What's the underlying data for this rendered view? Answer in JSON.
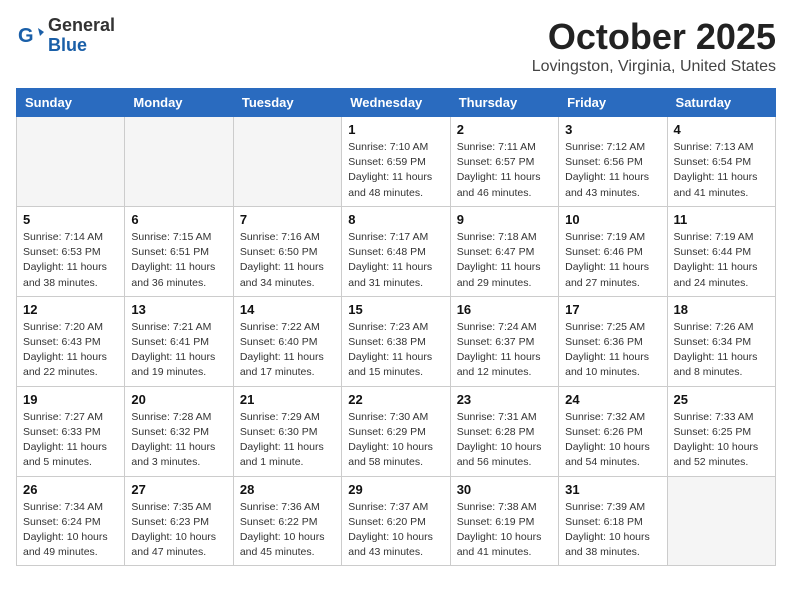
{
  "header": {
    "logo_general": "General",
    "logo_blue": "Blue",
    "month": "October 2025",
    "location": "Lovingston, Virginia, United States"
  },
  "weekdays": [
    "Sunday",
    "Monday",
    "Tuesday",
    "Wednesday",
    "Thursday",
    "Friday",
    "Saturday"
  ],
  "weeks": [
    [
      {
        "day": "",
        "info": ""
      },
      {
        "day": "",
        "info": ""
      },
      {
        "day": "",
        "info": ""
      },
      {
        "day": "1",
        "info": "Sunrise: 7:10 AM\nSunset: 6:59 PM\nDaylight: 11 hours and 48 minutes."
      },
      {
        "day": "2",
        "info": "Sunrise: 7:11 AM\nSunset: 6:57 PM\nDaylight: 11 hours and 46 minutes."
      },
      {
        "day": "3",
        "info": "Sunrise: 7:12 AM\nSunset: 6:56 PM\nDaylight: 11 hours and 43 minutes."
      },
      {
        "day": "4",
        "info": "Sunrise: 7:13 AM\nSunset: 6:54 PM\nDaylight: 11 hours and 41 minutes."
      }
    ],
    [
      {
        "day": "5",
        "info": "Sunrise: 7:14 AM\nSunset: 6:53 PM\nDaylight: 11 hours and 38 minutes."
      },
      {
        "day": "6",
        "info": "Sunrise: 7:15 AM\nSunset: 6:51 PM\nDaylight: 11 hours and 36 minutes."
      },
      {
        "day": "7",
        "info": "Sunrise: 7:16 AM\nSunset: 6:50 PM\nDaylight: 11 hours and 34 minutes."
      },
      {
        "day": "8",
        "info": "Sunrise: 7:17 AM\nSunset: 6:48 PM\nDaylight: 11 hours and 31 minutes."
      },
      {
        "day": "9",
        "info": "Sunrise: 7:18 AM\nSunset: 6:47 PM\nDaylight: 11 hours and 29 minutes."
      },
      {
        "day": "10",
        "info": "Sunrise: 7:19 AM\nSunset: 6:46 PM\nDaylight: 11 hours and 27 minutes."
      },
      {
        "day": "11",
        "info": "Sunrise: 7:19 AM\nSunset: 6:44 PM\nDaylight: 11 hours and 24 minutes."
      }
    ],
    [
      {
        "day": "12",
        "info": "Sunrise: 7:20 AM\nSunset: 6:43 PM\nDaylight: 11 hours and 22 minutes."
      },
      {
        "day": "13",
        "info": "Sunrise: 7:21 AM\nSunset: 6:41 PM\nDaylight: 11 hours and 19 minutes."
      },
      {
        "day": "14",
        "info": "Sunrise: 7:22 AM\nSunset: 6:40 PM\nDaylight: 11 hours and 17 minutes."
      },
      {
        "day": "15",
        "info": "Sunrise: 7:23 AM\nSunset: 6:38 PM\nDaylight: 11 hours and 15 minutes."
      },
      {
        "day": "16",
        "info": "Sunrise: 7:24 AM\nSunset: 6:37 PM\nDaylight: 11 hours and 12 minutes."
      },
      {
        "day": "17",
        "info": "Sunrise: 7:25 AM\nSunset: 6:36 PM\nDaylight: 11 hours and 10 minutes."
      },
      {
        "day": "18",
        "info": "Sunrise: 7:26 AM\nSunset: 6:34 PM\nDaylight: 11 hours and 8 minutes."
      }
    ],
    [
      {
        "day": "19",
        "info": "Sunrise: 7:27 AM\nSunset: 6:33 PM\nDaylight: 11 hours and 5 minutes."
      },
      {
        "day": "20",
        "info": "Sunrise: 7:28 AM\nSunset: 6:32 PM\nDaylight: 11 hours and 3 minutes."
      },
      {
        "day": "21",
        "info": "Sunrise: 7:29 AM\nSunset: 6:30 PM\nDaylight: 11 hours and 1 minute."
      },
      {
        "day": "22",
        "info": "Sunrise: 7:30 AM\nSunset: 6:29 PM\nDaylight: 10 hours and 58 minutes."
      },
      {
        "day": "23",
        "info": "Sunrise: 7:31 AM\nSunset: 6:28 PM\nDaylight: 10 hours and 56 minutes."
      },
      {
        "day": "24",
        "info": "Sunrise: 7:32 AM\nSunset: 6:26 PM\nDaylight: 10 hours and 54 minutes."
      },
      {
        "day": "25",
        "info": "Sunrise: 7:33 AM\nSunset: 6:25 PM\nDaylight: 10 hours and 52 minutes."
      }
    ],
    [
      {
        "day": "26",
        "info": "Sunrise: 7:34 AM\nSunset: 6:24 PM\nDaylight: 10 hours and 49 minutes."
      },
      {
        "day": "27",
        "info": "Sunrise: 7:35 AM\nSunset: 6:23 PM\nDaylight: 10 hours and 47 minutes."
      },
      {
        "day": "28",
        "info": "Sunrise: 7:36 AM\nSunset: 6:22 PM\nDaylight: 10 hours and 45 minutes."
      },
      {
        "day": "29",
        "info": "Sunrise: 7:37 AM\nSunset: 6:20 PM\nDaylight: 10 hours and 43 minutes."
      },
      {
        "day": "30",
        "info": "Sunrise: 7:38 AM\nSunset: 6:19 PM\nDaylight: 10 hours and 41 minutes."
      },
      {
        "day": "31",
        "info": "Sunrise: 7:39 AM\nSunset: 6:18 PM\nDaylight: 10 hours and 38 minutes."
      },
      {
        "day": "",
        "info": ""
      }
    ]
  ]
}
